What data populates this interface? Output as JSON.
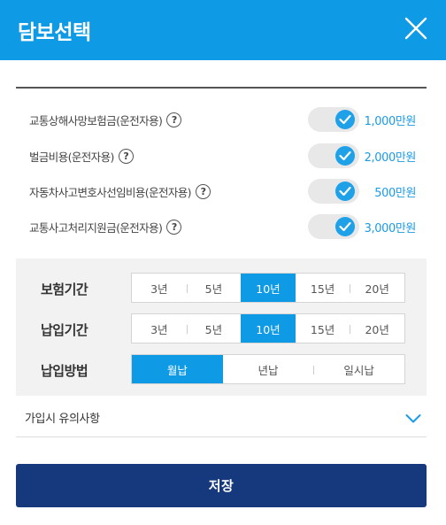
{
  "header": {
    "title": "담보선택",
    "close_icon": "close-icon"
  },
  "coverages": [
    {
      "label": "교통상해사망보험금(운전자용)",
      "help": "?",
      "checked": true,
      "amount": "1,000만원"
    },
    {
      "label": "벌금비용(운전자용)",
      "help": "?",
      "checked": true,
      "amount": "2,000만원"
    },
    {
      "label": "자동차사고변호사선임비용(운전자용)",
      "help": "?",
      "checked": true,
      "amount": "500만원"
    },
    {
      "label": "교통사고처리지원금(운전자용)",
      "help": "?",
      "checked": true,
      "amount": "3,000만원"
    }
  ],
  "options": {
    "insurance_period": {
      "label": "보험기간",
      "choices": [
        "3년",
        "5년",
        "10년",
        "15년",
        "20년"
      ],
      "selected": "10년"
    },
    "payment_period": {
      "label": "납입기간",
      "choices": [
        "3년",
        "5년",
        "10년",
        "15년",
        "20년"
      ],
      "selected": "10년"
    },
    "payment_method": {
      "label": "납입방법",
      "choices": [
        "월납",
        "년납",
        "일시납"
      ],
      "selected": "월납"
    }
  },
  "notice": {
    "label": "가입시 유의사항",
    "icon": "chevron-down-icon"
  },
  "save_label": "저장",
  "colors": {
    "header": "#0f9ae6",
    "accent": "#0f9ae6",
    "amount": "#1a9be6",
    "save": "#15397c",
    "panel": "#f2f2f2"
  }
}
